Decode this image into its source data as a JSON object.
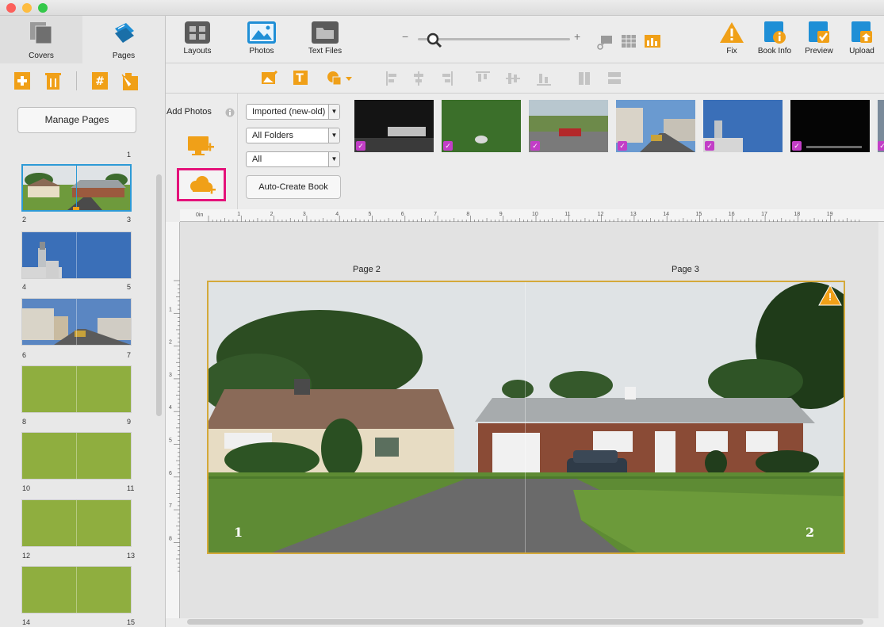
{
  "sidebar": {
    "tabs": [
      {
        "label": "Covers",
        "icon": "covers-icon"
      },
      {
        "label": "Pages",
        "icon": "pages-icon"
      }
    ],
    "tools": [
      "add-page-icon",
      "delete-page-icon",
      "page-number-icon",
      "page-style-icon"
    ],
    "manage_label": "Manage Pages",
    "first_page": "1",
    "spreads": [
      {
        "left": "2",
        "right": "3",
        "kind": "photo-house",
        "selected": true
      },
      {
        "left": "4",
        "right": "5",
        "kind": "photo-tower"
      },
      {
        "left": "6",
        "right": "7",
        "kind": "photo-street"
      },
      {
        "left": "8",
        "right": "9",
        "kind": "blank"
      },
      {
        "left": "10",
        "right": "11",
        "kind": "blank"
      },
      {
        "left": "12",
        "right": "13",
        "kind": "blank"
      },
      {
        "left": "14",
        "right": "15",
        "kind": "blank"
      }
    ]
  },
  "toolbar": {
    "layouts": "Layouts",
    "photos": "Photos",
    "text_files": "Text Files",
    "zoom_minus": "−",
    "zoom_plus": "+",
    "fix": "Fix",
    "book_info": "Book Info",
    "preview": "Preview",
    "upload": "Upload"
  },
  "photos_panel": {
    "add_photos": "Add Photos",
    "sort_select": "Imported (new-old)",
    "folder_select": "All Folders",
    "filter_select": "All",
    "auto_create": "Auto-Create Book",
    "check_mark": "✓"
  },
  "ruler": {
    "origin": "0in",
    "marks": [
      "1",
      "2",
      "3",
      "4",
      "5",
      "6",
      "7",
      "8",
      "9",
      "10",
      "11",
      "12",
      "13",
      "14",
      "15",
      "16",
      "17",
      "18",
      "19"
    ],
    "vmarks": [
      "1",
      "2",
      "3",
      "4",
      "5",
      "6",
      "7",
      "8"
    ]
  },
  "canvas": {
    "left_page_title": "Page 2",
    "right_page_title": "Page 3",
    "left_number": "1",
    "right_number": "2",
    "warning_symbol": "!"
  },
  "colors": {
    "accent_orange": "#f0a018",
    "accent_blue": "#1f8fd6",
    "highlight_pink": "#e4127a",
    "check_purple": "#c23ec7",
    "frame_gold": "#d4a93a"
  }
}
